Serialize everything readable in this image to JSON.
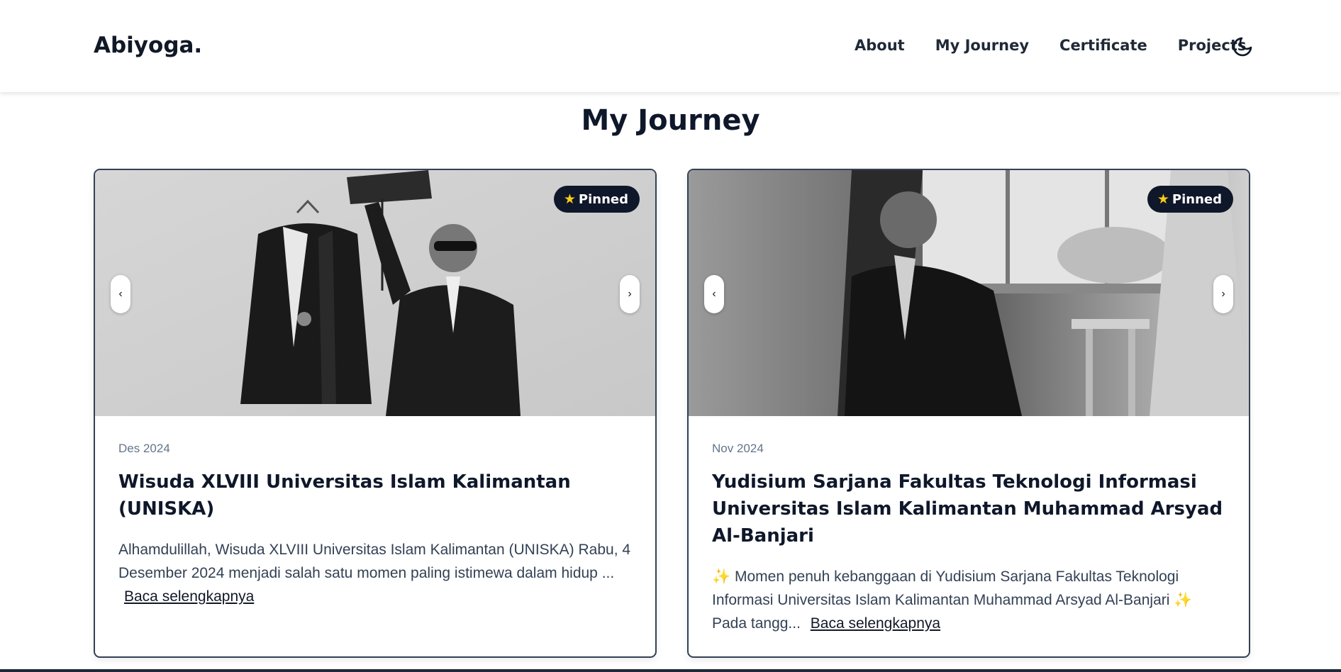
{
  "header": {
    "brand": "Abiyoga.",
    "nav": [
      {
        "label": "About"
      },
      {
        "label": "My Journey"
      },
      {
        "label": "Certificate"
      },
      {
        "label": "Projects"
      }
    ],
    "theme_icon": "moon-icon"
  },
  "section": {
    "title": "My Journey"
  },
  "cards": [
    {
      "badge": "Pinned",
      "badge_icon": "star-icon",
      "prev": "‹",
      "next": "›",
      "date": "Des 2024",
      "title": "Wisuda XLVIII Universitas Islam Kalimantan (UNISKA)",
      "excerpt": "Alhamdulillah, Wisuda XLVIII Universitas Islam Kalimantan (UNISKA) Rabu, 4 Desember 2024 menjadi salah satu momen paling istimewa dalam hidup ...",
      "read_more": "Baca selengkapnya"
    },
    {
      "badge": "Pinned",
      "badge_icon": "star-icon",
      "prev": "‹",
      "next": "›",
      "date": "Nov 2024",
      "title": "Yudisium Sarjana Fakultas Teknologi Informasi Universitas Islam Kalimantan Muhammad Arsyad Al-Banjari",
      "excerpt": "Momen penuh kebanggaan di Yudisium Sarjana Fakultas Teknologi Informasi Universitas Islam Kalimantan Muhammad Arsyad Al-Banjari ✨ Pada tangg...",
      "excerpt_icon": "sparkles-icon",
      "read_more": "Baca selengkapnya"
    }
  ],
  "colors": {
    "text": "#111827",
    "badge_bg": "#0f172a",
    "star": "#facc15",
    "border": "#334155"
  }
}
